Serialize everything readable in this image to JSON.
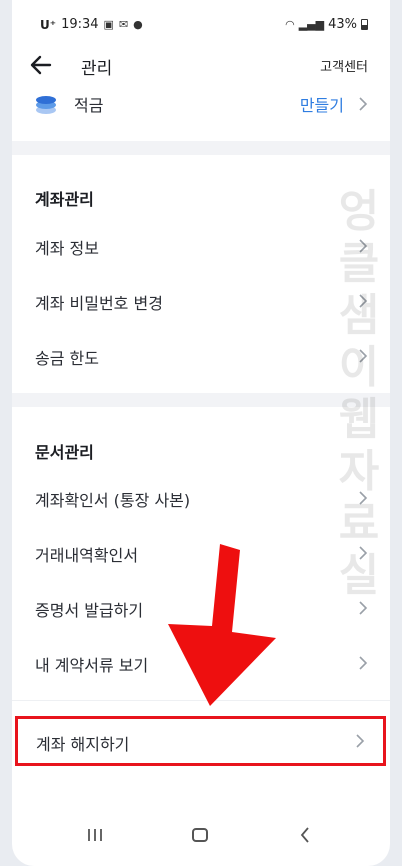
{
  "status_bar": {
    "carrier": "U⁺",
    "time": "19:34",
    "battery": "43%"
  },
  "app_bar": {
    "title": "관리",
    "customer_center": "고객센터"
  },
  "savings": {
    "label": "적금",
    "action": "만들기"
  },
  "account_section": {
    "title": "계좌관리",
    "items": [
      "계좌 정보",
      "계좌 비밀번호 변경",
      "송금 한도"
    ]
  },
  "document_section": {
    "title": "문서관리",
    "items": [
      "계좌확인서 (통장 사본)",
      "거래내역확인서",
      "증명서 발급하기",
      "내 계약서류 보기"
    ]
  },
  "close_account": {
    "label": "계좌 해지하기"
  },
  "watermark": [
    "엉",
    "클",
    "샘",
    "이",
    "웹",
    "자",
    "료",
    "실"
  ],
  "colors": {
    "accent": "#2f7de1",
    "highlight": "#e8141c"
  }
}
